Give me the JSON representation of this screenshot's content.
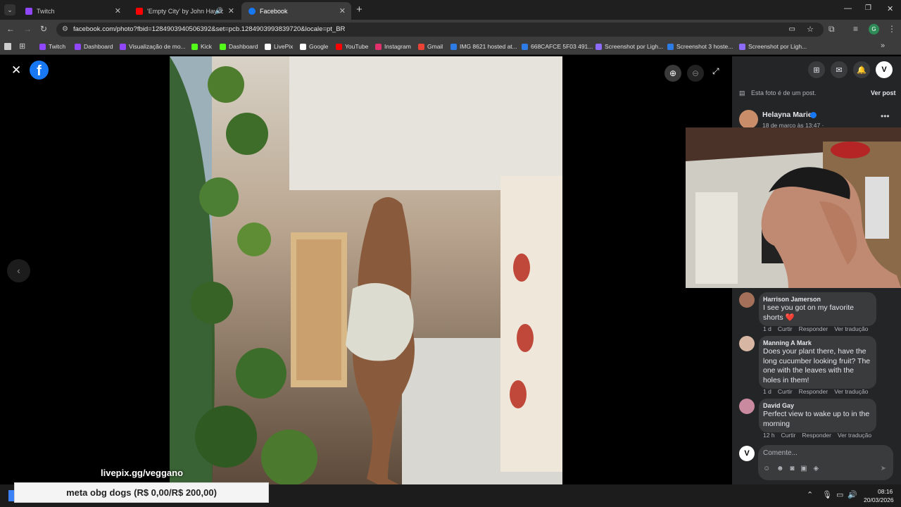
{
  "tabs": [
    {
      "label": "Twitch",
      "color": "#9146ff"
    },
    {
      "label": "'Empty City' by John Haydo",
      "color": "#ff0000"
    },
    {
      "label": "Facebook",
      "color": "#1877f2"
    }
  ],
  "address": {
    "url": "facebook.com/photo?fbid=1284903940506392&set=pcb.1284903993839720&locale=pt_BR"
  },
  "bookmarks": [
    {
      "label": "Twitch",
      "color": "#9146ff"
    },
    {
      "label": "Dashboard",
      "color": "#9146ff"
    },
    {
      "label": "Visualização de mo...",
      "color": "#9146ff"
    },
    {
      "label": "Kick",
      "color": "#53fc18"
    },
    {
      "label": "Dashboard",
      "color": "#53fc18"
    },
    {
      "label": "LivePix",
      "color": "#ffffff"
    },
    {
      "label": "Google",
      "color": "#ffffff"
    },
    {
      "label": "YouTube",
      "color": "#ff0000"
    },
    {
      "label": "Instagram",
      "color": "#e1306c"
    },
    {
      "label": "Gmail",
      "color": "#ea4335"
    },
    {
      "label": "IMG 8621 hosted at...",
      "color": "#2d7be5"
    },
    {
      "label": "668CAFCE 5F03 491...",
      "color": "#2d7be5"
    },
    {
      "label": "Screenshot por Ligh...",
      "color": "#8e6bff"
    },
    {
      "label": "Screenshot 3 hoste...",
      "color": "#2d7be5"
    },
    {
      "label": "Screenshot por Ligh...",
      "color": "#8e6bff"
    }
  ],
  "panel": {
    "post_notice": "Esta foto é de um post.",
    "view_post": "Ver post",
    "author": "Helayna Marie",
    "date": "18 de março às 13:47 · "
  },
  "comments": [
    {
      "name": "Harrison Jamerson",
      "text": "I see you got on my favorite shorts ❤️",
      "time": "1 d",
      "like": "Curtir",
      "reply": "Responder",
      "translate": "Ver tradução"
    },
    {
      "name": "Manning A Mark",
      "text": "Does your plant there, have the long cucumber looking fruit? The one with the leaves with the holes in them!",
      "time": "1 d",
      "like": "Curtir",
      "reply": "Responder",
      "translate": "Ver tradução"
    },
    {
      "name": "David Gay",
      "text": "Perfect view to wake up to in the morning",
      "time": "12 h",
      "like": "Curtir",
      "reply": "Responder",
      "translate": "Ver tradução"
    }
  ],
  "composer": {
    "placeholder": "Comente..."
  },
  "overlay": {
    "watermark": "livepix.gg/veggano",
    "goal": "meta obg dogs (R$ 0,00/R$ 200,00)"
  },
  "taskbar": {
    "time": "08:16",
    "date": "20/03/2026"
  }
}
